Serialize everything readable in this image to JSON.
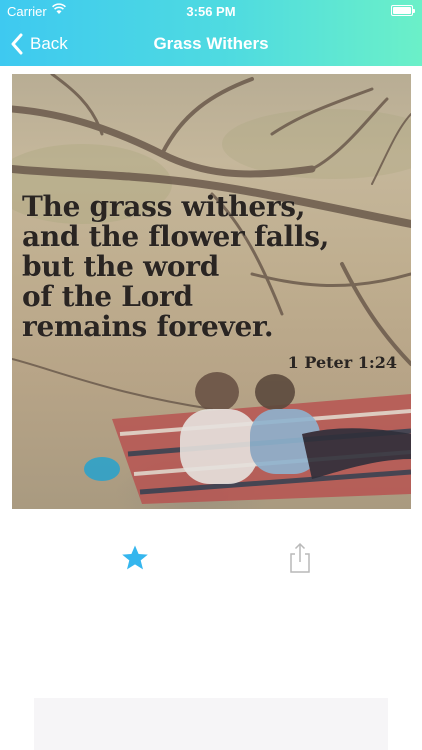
{
  "status_bar": {
    "carrier": "Carrier",
    "time": "3:56 PM",
    "wifi_icon": "wifi-icon",
    "battery_icon": "battery-icon"
  },
  "nav": {
    "back_label": "Back",
    "back_icon": "chevron-left-icon",
    "title": "Grass Withers"
  },
  "quote": {
    "lines": [
      "The grass withers,",
      "and the flower falls,",
      "but the word",
      "of the Lord",
      "remains forever."
    ],
    "reference": "1 Peter 1:24"
  },
  "actions": {
    "favorite_icon": "star-icon",
    "share_icon": "share-icon"
  },
  "colors": {
    "header_gradient_start": "#3ec9f0",
    "header_gradient_end": "#6bf0c8",
    "accent": "#35b6ee",
    "icon_gray": "#b9b9b9"
  }
}
